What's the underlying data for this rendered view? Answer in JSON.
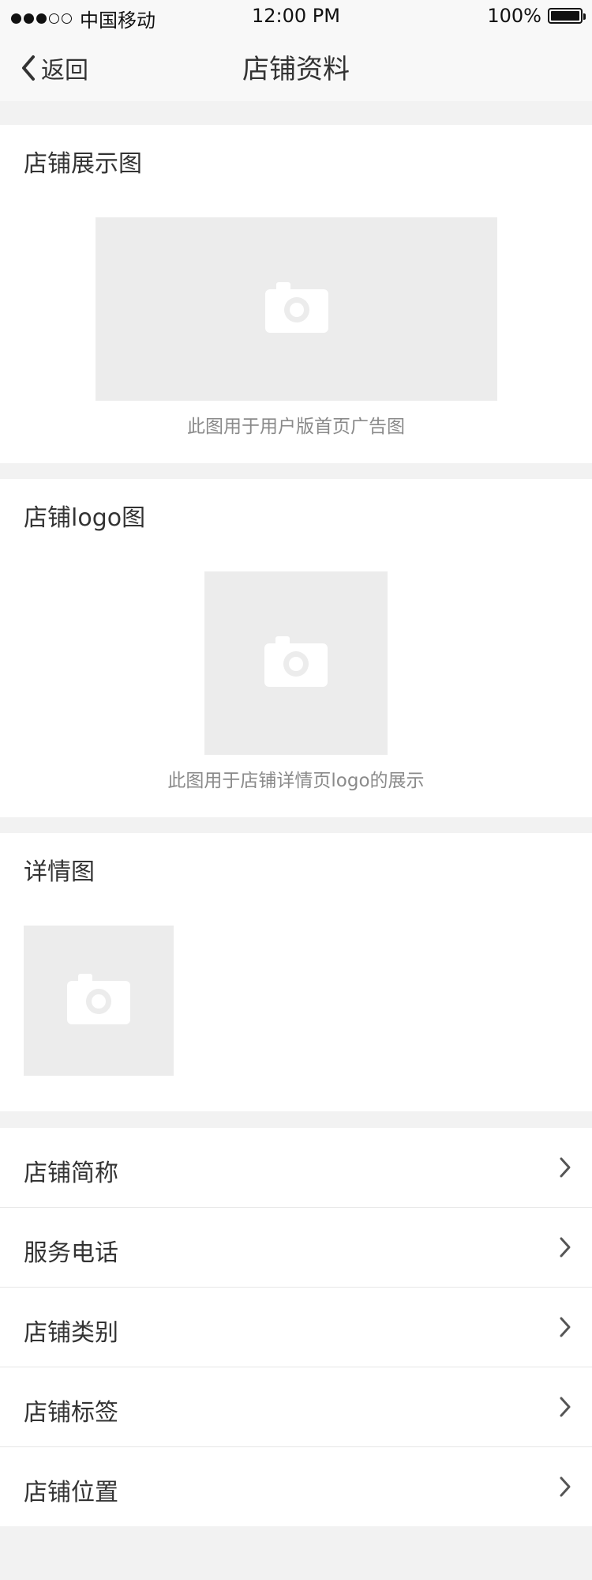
{
  "status_bar": {
    "carrier": "中国移动",
    "time": "12:00 PM",
    "battery": "100%",
    "signal_bars": 3,
    "signal_total": 5
  },
  "nav": {
    "back_label": "返回",
    "title": "店铺资料"
  },
  "sections": {
    "showcase": {
      "title": "店铺展示图",
      "caption": "此图用于用户版首页广告图"
    },
    "logo": {
      "title": "店铺logo图",
      "caption": "此图用于店铺详情页logo的展示"
    },
    "details": {
      "title": "详情图"
    }
  },
  "list_items": [
    {
      "label": "店铺简称"
    },
    {
      "label": "服务电话"
    },
    {
      "label": "店铺类别"
    },
    {
      "label": "店铺标签"
    },
    {
      "label": "店铺位置"
    }
  ],
  "icons": {
    "back": "chevron-left-icon",
    "camera": "camera-icon",
    "row_arrow": "chevron-right-icon"
  },
  "colors": {
    "page_background": "#f2f2f2",
    "card_background": "#ffffff",
    "placeholder": "#ececec",
    "caption_text": "#8a8a8a"
  }
}
